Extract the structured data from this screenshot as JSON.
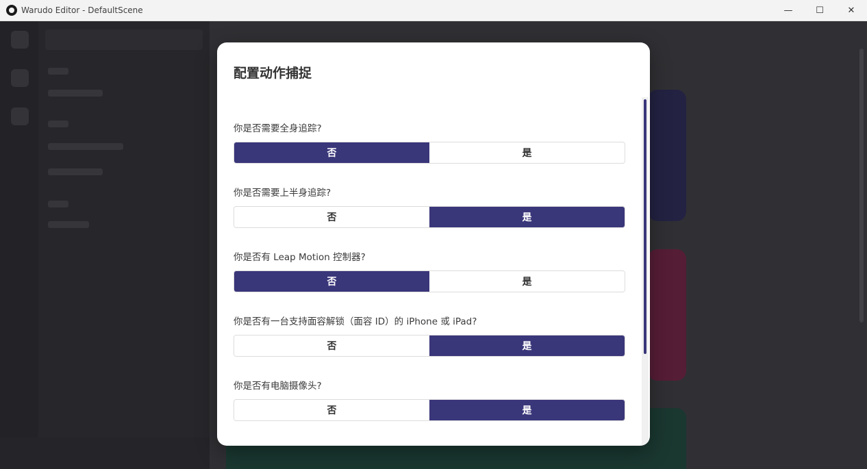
{
  "window": {
    "title": "Warudo Editor - DefaultScene",
    "controls": {
      "minimize": "—",
      "maximize": "☐",
      "close": "✕"
    }
  },
  "dialog": {
    "title": "配置动作捕捉",
    "questions": [
      {
        "label": "你是否需要全身追踪?",
        "options": [
          "否",
          "是"
        ],
        "selected": 0
      },
      {
        "label": "你是否需要上半身追踪?",
        "options": [
          "否",
          "是"
        ],
        "selected": 1
      },
      {
        "label": "你是否有 Leap Motion 控制器?",
        "options": [
          "否",
          "是"
        ],
        "selected": 0
      },
      {
        "label": "你是否有一台支持面容解锁（面容 ID）的 iPhone 或 iPad?",
        "options": [
          "否",
          "是"
        ],
        "selected": 1
      },
      {
        "label": "你是否有电脑摄像头?",
        "options": [
          "否",
          "是"
        ],
        "selected": 1
      }
    ]
  },
  "colors": {
    "accent": "#3a367a",
    "titlebar": "#f3f3f3"
  }
}
